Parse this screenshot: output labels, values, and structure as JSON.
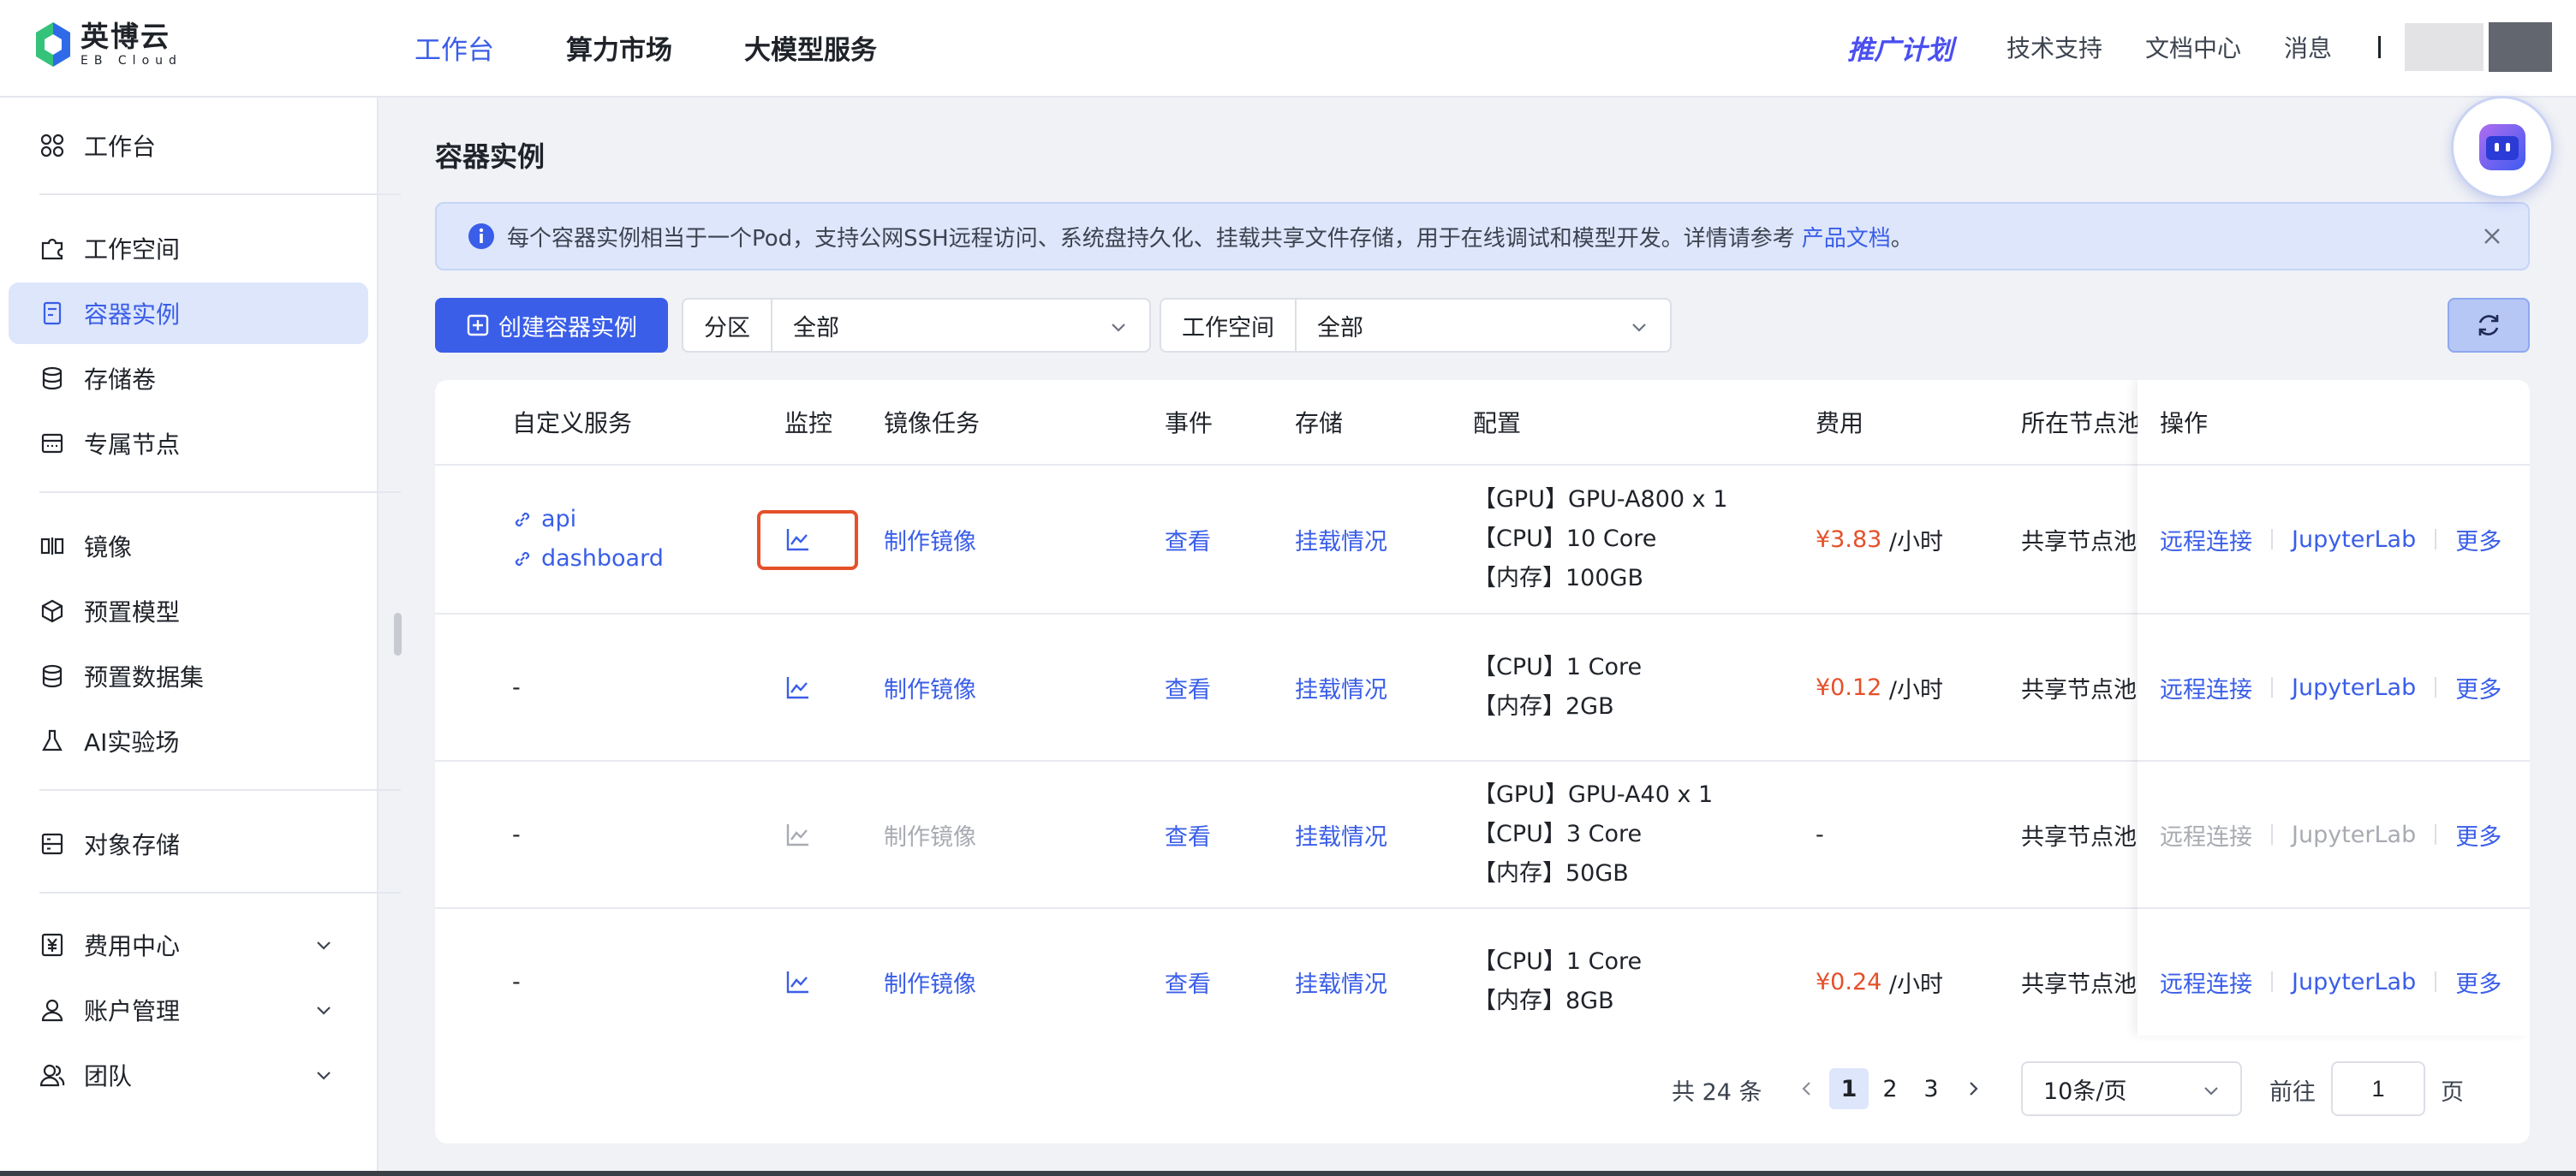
{
  "header": {
    "logo_cn": "英博云",
    "logo_en": "EB Cloud",
    "nav": [
      "工作台",
      "算力市场",
      "大模型服务"
    ],
    "promo": "推广计划",
    "links": [
      "技术支持",
      "文档中心",
      "消息"
    ]
  },
  "sidebar": {
    "items": [
      {
        "label": "工作台",
        "icon": "grid-icon"
      },
      {
        "label": "工作空间",
        "icon": "puzzle-icon"
      },
      {
        "label": "容器实例",
        "icon": "container-icon"
      },
      {
        "label": "存储卷",
        "icon": "database-icon"
      },
      {
        "label": "专属节点",
        "icon": "server-icon"
      },
      {
        "label": "镜像",
        "icon": "image-icon"
      },
      {
        "label": "预置模型",
        "icon": "cube-icon"
      },
      {
        "label": "预置数据集",
        "icon": "dataset-icon"
      },
      {
        "label": "AI实验场",
        "icon": "flask-icon"
      },
      {
        "label": "对象存储",
        "icon": "storage-icon"
      },
      {
        "label": "费用中心",
        "icon": "yen-icon"
      },
      {
        "label": "账户管理",
        "icon": "user-icon"
      },
      {
        "label": "团队",
        "icon": "team-icon"
      }
    ]
  },
  "main": {
    "title": "容器实例",
    "notice": {
      "text": "每个容器实例相当于一个Pod，支持公网SSH远程访问、系统盘持久化、挂载共享文件存储，用于在线调试和模型开发。详情请参考",
      "link": "产品文档",
      "suffix": "。"
    },
    "create_button": "创建容器实例",
    "filters": [
      {
        "label": "分区",
        "value": "全部"
      },
      {
        "label": "工作空间",
        "value": "全部"
      }
    ]
  },
  "table": {
    "columns": [
      "自定义服务",
      "监控",
      "镜像任务",
      "事件",
      "存储",
      "配置",
      "费用",
      "所在节点池",
      "操作"
    ],
    "rows": [
      {
        "services": [
          "api",
          "dashboard"
        ],
        "image_task": "制作镜像",
        "image_task_disabled": false,
        "event": "查看",
        "storage": "挂载情况",
        "config": [
          "【GPU】GPU-A800 x 1",
          "【CPU】10 Core",
          "【内存】100GB"
        ],
        "price": "¥3.83",
        "unit": "/小时",
        "pool": "共享节点池",
        "monitor_disabled": false,
        "ops_disabled": false
      },
      {
        "services": [
          "-"
        ],
        "image_task": "制作镜像",
        "image_task_disabled": false,
        "event": "查看",
        "storage": "挂载情况",
        "config": [
          "【CPU】1 Core",
          "【内存】2GB"
        ],
        "price": "¥0.12",
        "unit": "/小时",
        "pool": "共享节点池",
        "monitor_disabled": false,
        "ops_disabled": false
      },
      {
        "services": [
          "-"
        ],
        "image_task": "制作镜像",
        "image_task_disabled": true,
        "event": "查看",
        "storage": "挂载情况",
        "config": [
          "【GPU】GPU-A40 x 1",
          "【CPU】3 Core",
          "【内存】50GB"
        ],
        "price": "-",
        "unit": "",
        "pool": "共享节点池",
        "monitor_disabled": true,
        "ops_disabled": true
      },
      {
        "services": [
          "-"
        ],
        "image_task": "制作镜像",
        "image_task_disabled": false,
        "event": "查看",
        "storage": "挂载情况",
        "config": [
          "【CPU】1 Core",
          "【内存】8GB"
        ],
        "price": "¥0.24",
        "unit": "/小时",
        "pool": "共享节点池",
        "monitor_disabled": false,
        "ops_disabled": false
      }
    ],
    "ops": [
      "远程连接",
      "JupyterLab",
      "更多"
    ]
  },
  "pager": {
    "total": "共 24 条",
    "pages": [
      "1",
      "2",
      "3"
    ],
    "current": "1",
    "page_size": "10条/页",
    "goto_label": "前往",
    "goto_value": "1",
    "page_label": "页"
  },
  "colors": {
    "accent": "#3a5ee8",
    "price": "#e5502a",
    "highlight": "#e5502a"
  }
}
